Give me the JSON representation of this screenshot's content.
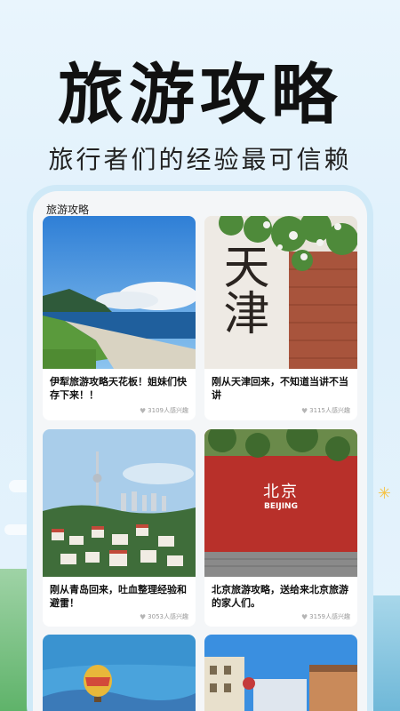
{
  "hero": {
    "title": "旅游攻略",
    "subtitle": "旅行者们的经验最可信赖"
  },
  "screen": {
    "title": "旅游攻略"
  },
  "cards": [
    {
      "title": "伊犁旅游攻略天花板！姐妹们快存下来！！",
      "interest": "3109人感兴趣",
      "image": "lake-landscape"
    },
    {
      "title": "刚从天津回来，不知道当讲不当讲",
      "interest": "3115人感兴趣",
      "image": "tianjin-sign"
    },
    {
      "title": "刚从青岛回来，吐血整理经验和避雷！",
      "interest": "3053人感兴趣",
      "image": "qingdao-city"
    },
    {
      "title": "北京旅游攻略，送给来北京旅游的家人们。",
      "interest": "3159人感兴趣",
      "image": "beijing-wall"
    },
    {
      "title": "",
      "interest": "",
      "image": "balloon"
    },
    {
      "title": "",
      "interest": "",
      "image": "street"
    }
  ],
  "tianjin_sign_text": "天津",
  "beijing_sign": {
    "cn": "北京",
    "en": "BEIJING"
  },
  "colors": {
    "accent": "#cfe9f7",
    "text": "#111111"
  }
}
